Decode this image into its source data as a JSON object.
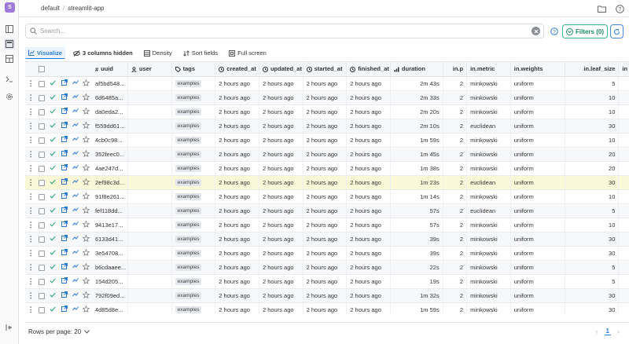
{
  "app": {
    "logo_letter": "S",
    "breadcrumb": [
      "default",
      "streamlit-app"
    ]
  },
  "search": {
    "placeholder": "Search...",
    "value": ""
  },
  "filters": {
    "label": "Filters (0)"
  },
  "toolbar": {
    "visualize": "Visualize",
    "hidden": "3 columns hidden",
    "density": "Density",
    "sort": "Sort fields",
    "fullscreen": "Full screen"
  },
  "table": {
    "headers": [
      "uuid",
      "user",
      "tags",
      "created_at",
      "updated_at",
      "started_at",
      "finished_at",
      "duration",
      "in.p",
      "in.metric",
      "in.weights",
      "in.leaf_size",
      "in"
    ],
    "rows": [
      {
        "uuid": "af5bd548...",
        "tag": "examples",
        "created": "2 hours ago",
        "updated": "2 hours ago",
        "started": "2 hours ago",
        "finished": "2 hours ago",
        "duration": "2m 43s",
        "p": "2",
        "metric": "minkowski",
        "weights": "uniform",
        "leaf": "5"
      },
      {
        "uuid": "6d6485a...",
        "tag": "examples",
        "created": "2 hours ago",
        "updated": "2 hours ago",
        "started": "2 hours ago",
        "finished": "2 hours ago",
        "duration": "2m 33s",
        "p": "2",
        "metric": "minkowski",
        "weights": "uniform",
        "leaf": "10"
      },
      {
        "uuid": "da0eda2...",
        "tag": "examples",
        "created": "2 hours ago",
        "updated": "2 hours ago",
        "started": "2 hours ago",
        "finished": "2 hours ago",
        "duration": "2m 20s",
        "p": "2",
        "metric": "minkowski",
        "weights": "uniform",
        "leaf": "10"
      },
      {
        "uuid": "f559dd61...",
        "tag": "examples",
        "created": "2 hours ago",
        "updated": "2 hours ago",
        "started": "2 hours ago",
        "finished": "2 hours ago",
        "duration": "2m 10s",
        "p": "2",
        "metric": "euclidean",
        "weights": "uniform",
        "leaf": "30"
      },
      {
        "uuid": "4cb0c98...",
        "tag": "examples",
        "created": "2 hours ago",
        "updated": "2 hours ago",
        "started": "2 hours ago",
        "finished": "2 hours ago",
        "duration": "1m 59s",
        "p": "2",
        "metric": "minkowski",
        "weights": "uniform",
        "leaf": "10"
      },
      {
        "uuid": "352feec0...",
        "tag": "examples",
        "created": "2 hours ago",
        "updated": "2 hours ago",
        "started": "2 hours ago",
        "finished": "2 hours ago",
        "duration": "1m 45s",
        "p": "2",
        "metric": "minkowski",
        "weights": "uniform",
        "leaf": "20"
      },
      {
        "uuid": "4ae247d...",
        "tag": "examples",
        "created": "2 hours ago",
        "updated": "2 hours ago",
        "started": "2 hours ago",
        "finished": "2 hours ago",
        "duration": "1m 38s",
        "p": "2",
        "metric": "minkowski",
        "weights": "uniform",
        "leaf": "20"
      },
      {
        "uuid": "2ef98c3d...",
        "tag": "examples",
        "created": "2 hours ago",
        "updated": "2 hours ago",
        "started": "2 hours ago",
        "finished": "2 hours ago",
        "duration": "1m 23s",
        "p": "2",
        "metric": "euclidean",
        "weights": "uniform",
        "leaf": "30",
        "highlight": true
      },
      {
        "uuid": "91f8e261...",
        "tag": "examples",
        "created": "2 hours ago",
        "updated": "2 hours ago",
        "started": "2 hours ago",
        "finished": "2 hours ago",
        "duration": "1m 14s",
        "p": "2",
        "metric": "minkowski",
        "weights": "uniform",
        "leaf": "10"
      },
      {
        "uuid": "fef118dd...",
        "tag": "examples",
        "created": "2 hours ago",
        "updated": "2 hours ago",
        "started": "2 hours ago",
        "finished": "2 hours ago",
        "duration": "57s",
        "p": "2",
        "metric": "euclidean",
        "weights": "uniform",
        "leaf": "5"
      },
      {
        "uuid": "9413e17...",
        "tag": "examples",
        "created": "2 hours ago",
        "updated": "2 hours ago",
        "started": "2 hours ago",
        "finished": "2 hours ago",
        "duration": "57s",
        "p": "2",
        "metric": "minkowski",
        "weights": "uniform",
        "leaf": "10"
      },
      {
        "uuid": "6133d41...",
        "tag": "examples",
        "created": "2 hours ago",
        "updated": "2 hours ago",
        "started": "2 hours ago",
        "finished": "2 hours ago",
        "duration": "39s",
        "p": "2",
        "metric": "minkowski",
        "weights": "uniform",
        "leaf": "30"
      },
      {
        "uuid": "3e54708...",
        "tag": "examples",
        "created": "2 hours ago",
        "updated": "2 hours ago",
        "started": "2 hours ago",
        "finished": "2 hours ago",
        "duration": "39s",
        "p": "2",
        "metric": "minkowski",
        "weights": "uniform",
        "leaf": "30"
      },
      {
        "uuid": "b6cdaaee...",
        "tag": "examples",
        "created": "2 hours ago",
        "updated": "2 hours ago",
        "started": "2 hours ago",
        "finished": "2 hours ago",
        "duration": "22s",
        "p": "2",
        "metric": "minkowski",
        "weights": "uniform",
        "leaf": "5"
      },
      {
        "uuid": "154d205...",
        "tag": "examples",
        "created": "2 hours ago",
        "updated": "2 hours ago",
        "started": "2 hours ago",
        "finished": "2 hours ago",
        "duration": "19s",
        "p": "2",
        "metric": "minkowski",
        "weights": "uniform",
        "leaf": "5"
      },
      {
        "uuid": "792f09ed...",
        "tag": "examples",
        "created": "2 hours ago",
        "updated": "2 hours ago",
        "started": "2 hours ago",
        "finished": "2 hours ago",
        "duration": "1m 32s",
        "p": "2",
        "metric": "minkowski",
        "weights": "uniform",
        "leaf": "30"
      },
      {
        "uuid": "4d85d8e...",
        "tag": "examples",
        "created": "2 hours ago",
        "updated": "2 hours ago",
        "started": "2 hours ago",
        "finished": "2 hours ago",
        "duration": "1m 59s",
        "p": "2",
        "metric": "minkowski",
        "weights": "uniform",
        "leaf": "30"
      }
    ]
  },
  "footer": {
    "rows_per_page_label": "Rows per page: 20",
    "current_page": "1"
  },
  "colors": {
    "accent": "#2b7bd6",
    "success": "#3aa882",
    "highlight": "#fbf8d8",
    "logo": "#9d7ad8"
  }
}
